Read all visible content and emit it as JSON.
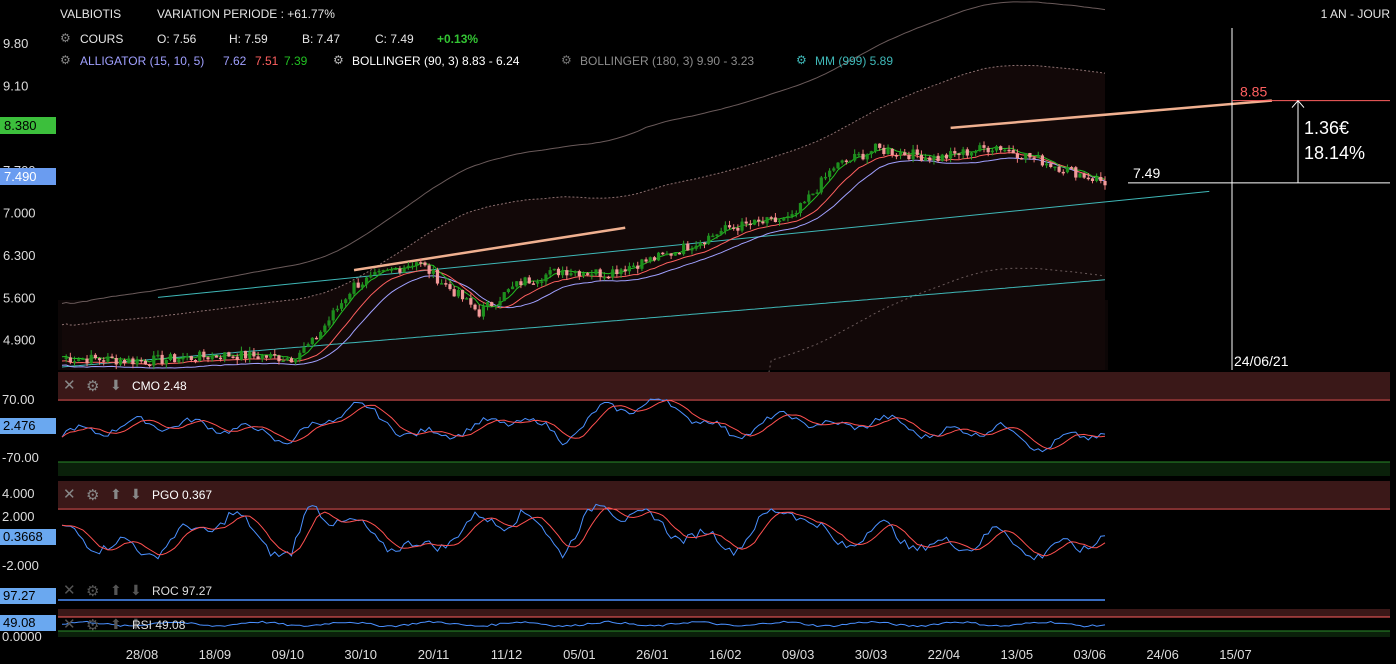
{
  "header": {
    "ticker": "VALBIOTIS",
    "variation": "VARIATION PERIODE : +61.77%",
    "period": "1 AN - JOUR"
  },
  "quote": {
    "label": "COURS",
    "open": "O: 7.56",
    "high": "H: 7.59",
    "low": "B: 7.47",
    "close": "C: 7.49",
    "change": "+0.13%"
  },
  "indicators": {
    "alligator_label": "ALLIGATOR (15, 10, 5)",
    "alligator_v1": "7.62",
    "alligator_v2": "7.51",
    "alligator_v3": "7.39",
    "bollinger1": "BOLLINGER (90, 3)  8.83 - 6.24",
    "bollinger2": "BOLLINGER (180, 3)  9.90 - 3.23",
    "mm": "MM (999)  5.89"
  },
  "colors": {
    "up": "#2aa52a",
    "down": "#f07a7a",
    "accent_green": "#33c433",
    "alligator1": "#a0a0ff",
    "alligator2": "#ff6060",
    "alligator3": "#22c022",
    "bollinger": "#8c8c8c",
    "mm": "#3fb8b8",
    "trend": "#f0b090",
    "sub_blue": "#4a90ff",
    "sub_red": "#ff5050"
  },
  "price_axis": {
    "ticks": [
      "9.80",
      "9.10",
      "8.380",
      "7.700",
      "7.490",
      "7.000",
      "6.300",
      "5.600",
      "4.900"
    ],
    "tick_values": [
      9.8,
      9.1,
      8.38,
      7.7,
      7.49,
      7.0,
      6.3,
      5.6,
      4.9
    ],
    "range": [
      4.4,
      9.95
    ],
    "badge_green": "8.380",
    "badge_blue": "7.490"
  },
  "annotations": {
    "target_price": "8.85",
    "target_value": 8.85,
    "current_price": "7.49",
    "current_value": 7.49,
    "gain_amount": "1.36€",
    "gain_percent": "18.14%",
    "projection_date": "24/06/21"
  },
  "x_axis": {
    "labels": [
      "28/08",
      "18/09",
      "09/10",
      "30/10",
      "20/11",
      "11/12",
      "05/01",
      "26/01",
      "16/02",
      "09/03",
      "30/03",
      "22/04",
      "13/05",
      "03/06",
      "24/06",
      "15/07"
    ]
  },
  "cmo": {
    "name": "CMO",
    "value": "2.48",
    "badge": "2.476",
    "ticks": [
      "70.00",
      "-70.00"
    ]
  },
  "pgo": {
    "name": "PGO",
    "value": "0.367",
    "badge": "0.3668",
    "ticks": [
      "4.000",
      "2.000",
      "-2.000"
    ]
  },
  "roc": {
    "name": "ROC",
    "value": "97.27",
    "badge": "97.27"
  },
  "rsi": {
    "name": "RSI",
    "value": "49.08",
    "badge": "49.08",
    "tick_zero": "0.0000"
  },
  "chart_data": {
    "type": "candlestick",
    "series_keypoints": {
      "x_index": [
        0,
        20,
        40,
        55,
        60,
        70,
        85,
        100,
        110,
        120,
        130,
        145,
        160,
        175,
        185,
        195,
        210,
        224,
        235,
        250
      ],
      "close": [
        4.6,
        4.55,
        4.65,
        4.6,
        4.85,
        5.8,
        6.2,
        5.35,
        5.85,
        6.05,
        6.0,
        6.3,
        6.75,
        6.9,
        7.75,
        8.05,
        7.9,
        8.1,
        7.85,
        7.5
      ]
    },
    "cmo_shape": [
      -10,
      20,
      10,
      -20,
      5,
      65,
      -15,
      10,
      35,
      -20,
      55,
      70,
      -10,
      40,
      5,
      30,
      -10,
      10,
      -40,
      2.48
    ],
    "pgo_shape": [
      0.5,
      -1,
      2,
      -1.5,
      3,
      1,
      -1,
      1.5,
      2,
      -0.5,
      3,
      1,
      -0.5,
      3,
      -0.5,
      1,
      -0.8,
      0.5,
      -1.2,
      0.37
    ],
    "trendlines": [
      {
        "name": "upper-trend-1",
        "from": [
          70,
          6.05
        ],
        "to": [
          135,
          6.75
        ]
      },
      {
        "name": "upper-trend-2",
        "from": [
          213,
          8.4
        ],
        "to": [
          290,
          8.85
        ]
      },
      {
        "name": "support-channel",
        "from": [
          23,
          5.6
        ],
        "to": [
          275,
          7.35
        ]
      }
    ]
  }
}
